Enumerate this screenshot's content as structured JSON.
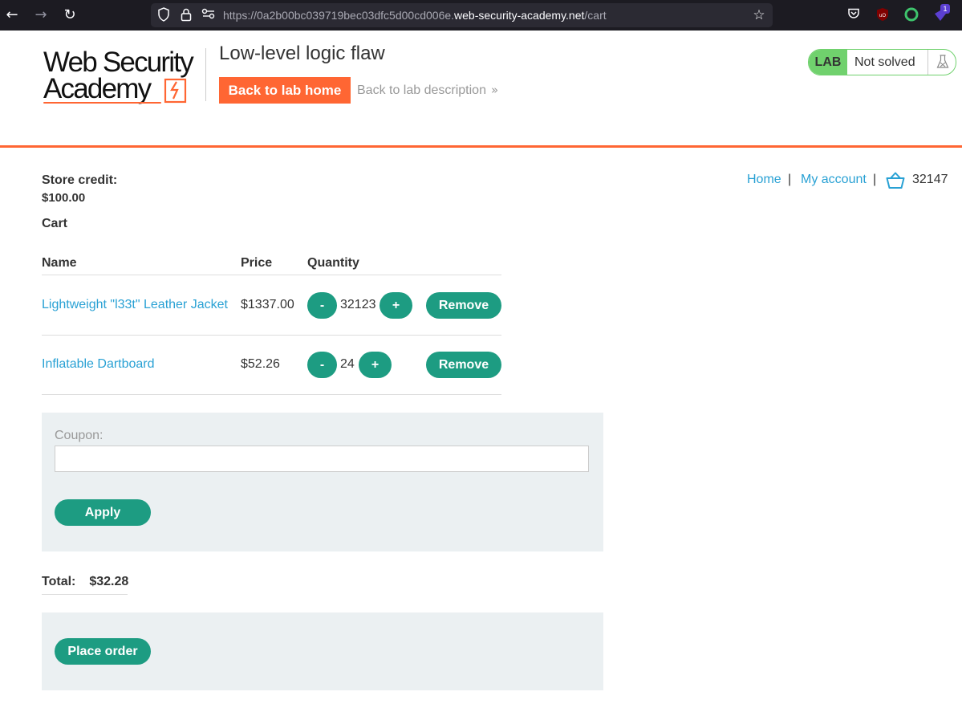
{
  "browser": {
    "url_dim_prefix": "https://0a2b00bc039719bec03dfc5d00cd006e.",
    "url_domain": "web-security-academy.net",
    "url_path": "/cart",
    "extension_badge": "1",
    "icons": [
      "back-arrow-icon",
      "forward-arrow-icon",
      "reload-icon",
      "shield-icon",
      "lock-icon",
      "permissions-icon",
      "star-icon",
      "pocket-icon",
      "ublock-icon",
      "extension-icon"
    ]
  },
  "header": {
    "logo_line1": "Web Security",
    "logo_line2": "Academy",
    "lab_title": "Low-level logic flaw",
    "back_home_label": "Back to lab home",
    "back_description_label": "Back to lab description",
    "lab_badge": "LAB",
    "lab_status": "Not solved"
  },
  "store": {
    "credit_label": "Store credit:",
    "credit_value": "$100.00",
    "cart_title": "Cart",
    "nav": {
      "home": "Home",
      "separator": "|",
      "my_account": "My account",
      "cart_count": "32147"
    },
    "table": {
      "headers": [
        "Name",
        "Price",
        "Quantity"
      ],
      "rows": [
        {
          "name": "Lightweight \"l33t\" Leather Jacket",
          "price": "$1337.00",
          "quantity": "32123"
        },
        {
          "name": "Inflatable Dartboard",
          "price": "$52.26",
          "quantity": "24"
        }
      ],
      "minus_label": "-",
      "plus_label": "+",
      "remove_label": "Remove"
    },
    "coupon": {
      "label": "Coupon:",
      "value": "",
      "apply_label": "Apply"
    },
    "total": {
      "label": "Total:",
      "value": "$32.28"
    },
    "place_order_label": "Place order"
  },
  "colors": {
    "accent_orange": "#ff6633",
    "button_green": "#1d9c82",
    "lab_green": "#70d16d",
    "link_blue": "#29a1d4"
  }
}
